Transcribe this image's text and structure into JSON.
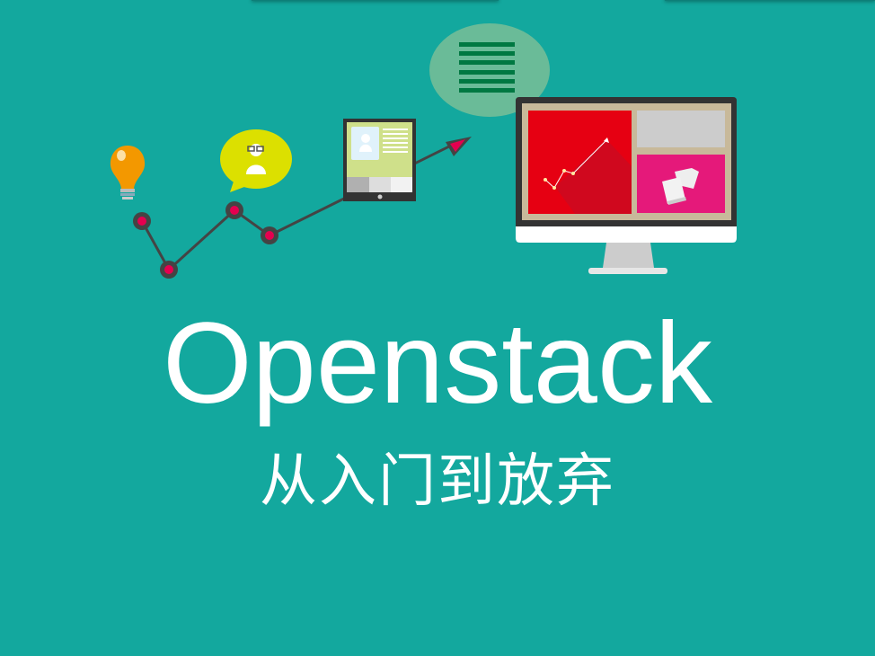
{
  "slide": {
    "title": "Openstack",
    "subtitle": "从入门到放弃"
  },
  "colors": {
    "background": "#13A89E",
    "bulb": "#F39800",
    "bubble_yellow": "#DCE000",
    "bubble_green": "#6ABB98",
    "screen_red": "#E60012",
    "screen_pink": "#E5197A"
  },
  "icons": [
    "lightbulb-icon",
    "person-bubble-icon",
    "tablet-icon",
    "document-bubble-icon",
    "monitor-icon",
    "growth-line-icon"
  ]
}
